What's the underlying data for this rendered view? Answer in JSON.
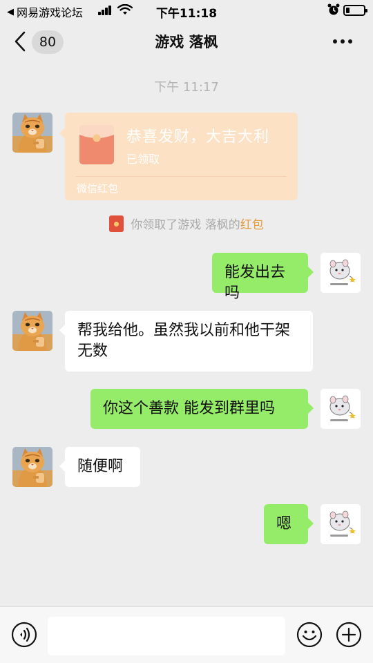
{
  "status_bar": {
    "back_app": "网易游戏论坛",
    "time": "下午11:18",
    "battery_level": 0.2
  },
  "nav": {
    "unread_count": "80",
    "title": "游戏 落枫"
  },
  "timestamp": "下午 11:17",
  "red_packet": {
    "title": "恭喜发财，大吉大利",
    "status": "已领取",
    "footer": "微信红包"
  },
  "system_message": {
    "prefix": "你领取了游戏 落枫的",
    "link": "红包"
  },
  "messages": [
    {
      "from": "me",
      "text": "能发出去吗"
    },
    {
      "from": "other",
      "text": "帮我给他。虽然我以前和他干架无数"
    },
    {
      "from": "me",
      "text": "你这个善款 能发到群里吗"
    },
    {
      "from": "other",
      "text": "随便啊"
    },
    {
      "from": "me",
      "text": "嗯"
    }
  ],
  "colors": {
    "background": "#ededed",
    "outgoing_bubble": "#95ec69",
    "incoming_bubble": "#ffffff",
    "red_packet_received": "#fce1c5",
    "link_orange": "#e49a3a"
  },
  "icons": {
    "voice": "voice-icon",
    "emoji": "emoji-icon",
    "plus": "plus-icon",
    "more": "more-icon",
    "back": "back-chevron-icon"
  }
}
